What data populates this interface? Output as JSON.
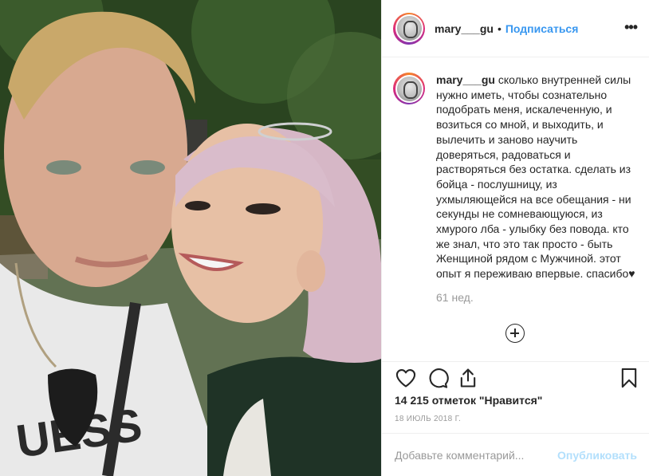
{
  "post": {
    "username": "mary___gu",
    "follow_label": "Подписаться",
    "separator": "•",
    "more_icon": "more-horizontal-icon"
  },
  "caption": {
    "username": "mary___gu",
    "text": "сколько внутренней силы нужно иметь, чтобы сознательно подобрать меня, искалеченную, и возиться со мной, и выходить, и вылечить и заново научить доверяться, радоваться и растворяться без остатка. сделать из бойца - послушницу, из ухмыляющейся на все обещания - ни секунды не сомневающуюся, из хмурого лба - улыбку без повода. кто же знал, что это так просто - быть Женщиной рядом с Мужчиной. этот опыт я переживаю впервые. спасибо♥",
    "time": "61 нед."
  },
  "actions": {
    "like_icon": "heart-icon",
    "comment_icon": "comment-icon",
    "share_icon": "share-icon",
    "save_icon": "bookmark-icon",
    "load_more_icon": "plus-circle-icon"
  },
  "likes": "14 215 отметок \"Нравится\"",
  "date": "18 ИЮЛЬ 2018 Г.",
  "comment_box": {
    "placeholder": "Добавьте комментарий...",
    "post_label": "Опубликовать"
  },
  "colors": {
    "accent": "#3897f0",
    "post_disabled": "#b2dffc",
    "muted": "#999999",
    "border": "#efefef"
  }
}
